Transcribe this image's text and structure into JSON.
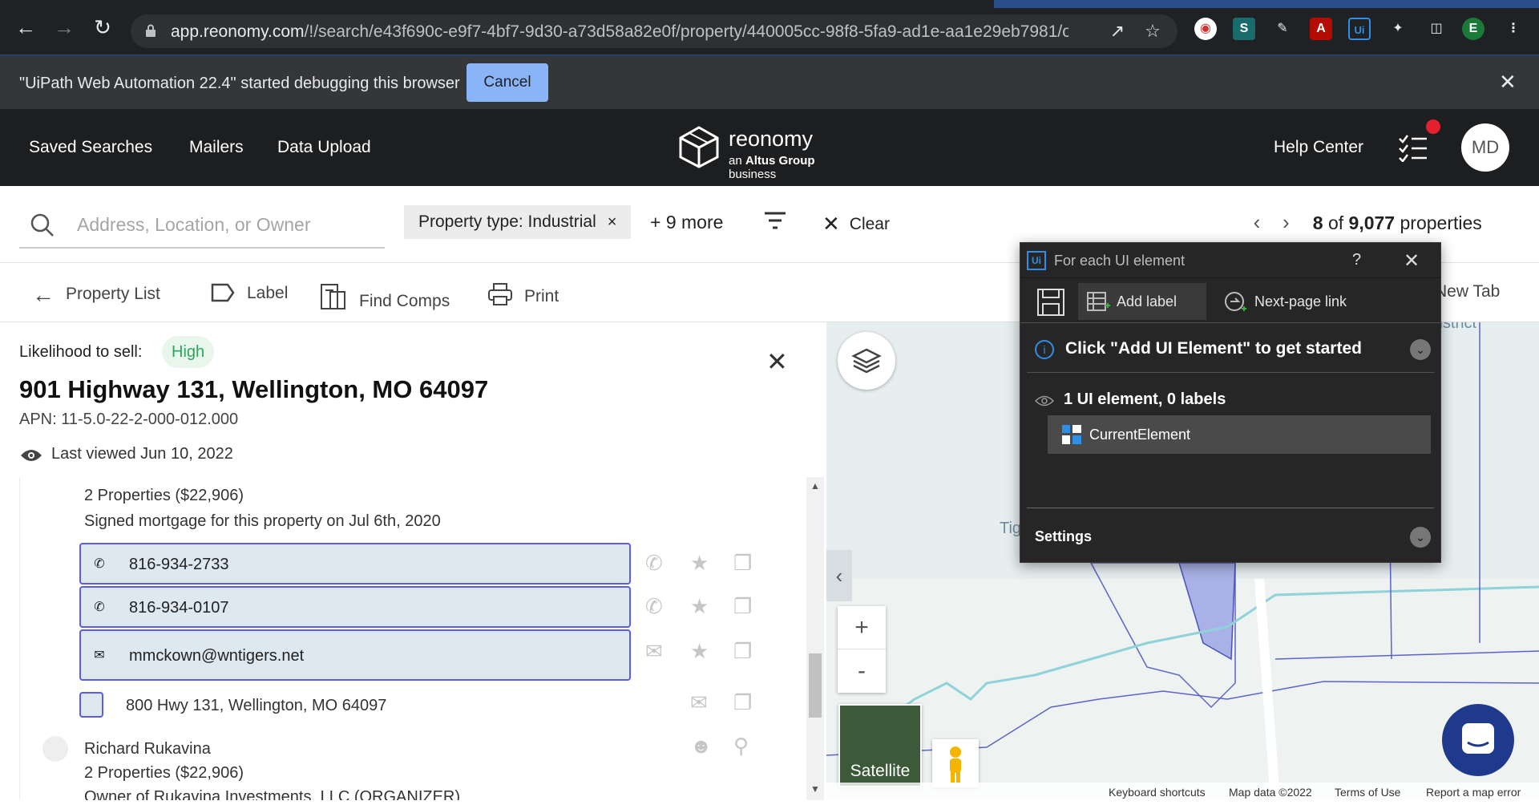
{
  "browser": {
    "url_host": "app.reonomy.com",
    "url_path": "/!/search/e43f690c-e9f7-4bf7-9d30-a73d58a82e0f/property/440005cc-98f8-5fa9-ad1e-aa1e29eb7981/o...",
    "extensions": [
      "color-picker-icon",
      "s-extension-icon",
      "pen-extension-icon",
      "acrobat-icon",
      "uipath-icon",
      "puzzle-icon",
      "side-panel-icon"
    ],
    "profile_initial": "E"
  },
  "infobar": {
    "message": "\"UiPath Web Automation 22.4\" started debugging this browser",
    "cancel_label": "Cancel"
  },
  "header": {
    "nav": [
      "Saved Searches",
      "Mailers",
      "Data Upload"
    ],
    "logo_name": "reonomy",
    "logo_tag_prefix": "an",
    "logo_tag_brand": "Altus Group",
    "logo_tag_suffix": "business",
    "help_label": "Help Center",
    "avatar_initials": "MD"
  },
  "search": {
    "placeholder": "Address, Location, or Owner",
    "chip_label": "Property type: Industrial",
    "more_label": "+ 9 more",
    "clear_label": "Clear",
    "pager_current": "8",
    "pager_of": "of",
    "pager_total": "9,077",
    "pager_unit": "properties"
  },
  "actions": {
    "property_list": "Property List",
    "label": "Label",
    "find_comps": "Find Comps",
    "print": "Print",
    "new_tab": "New Tab"
  },
  "property": {
    "likelihood_label": "Likelihood to sell:",
    "likelihood_value": "High",
    "address": "901 Highway 131, Wellington, MO 64097",
    "apn": "APN: 11-5.0-22-2-000-012.000",
    "last_viewed": "Last viewed Jun 10, 2022"
  },
  "contacts": {
    "properties_line": "2 Properties ($22,906)",
    "mortgage_line": "Signed mortgage for this property on Jul 6th, 2020",
    "phone1": "816-934-2733",
    "phone2": "816-934-0107",
    "email": "mmckown@wntigers.net",
    "mailing_address": "800 Hwy 131, Wellington, MO 64097",
    "person2_name": "Richard Rukavina",
    "person2_properties": "2 Properties ($22,906)",
    "person2_role": "Owner of Rukavina Investments, LLC (ORGANIZER)"
  },
  "map": {
    "district_label": "l District",
    "tig_label": "Tig",
    "satellite_label": "Satellite",
    "zoom_in": "+",
    "zoom_out": "-",
    "footer": [
      "Keyboard shortcuts",
      "Map data ©2022",
      "Terms of Use",
      "Report a map error"
    ]
  },
  "uipath": {
    "title": "For each UI element",
    "help": "?",
    "add_label": "Add label",
    "next_page": "Next-page link",
    "info": "Click \"Add UI Element\" to get started",
    "count": "1 UI element, 0 labels",
    "current_element": "CurrentElement",
    "settings": "Settings"
  },
  "colors": {
    "header_bg": "#1d1e20",
    "contact_border": "#5b5bf0",
    "contact_bg": "#dde8f1",
    "high_badge": "#2ea55b",
    "uipath_accent": "#2f8fe6"
  }
}
